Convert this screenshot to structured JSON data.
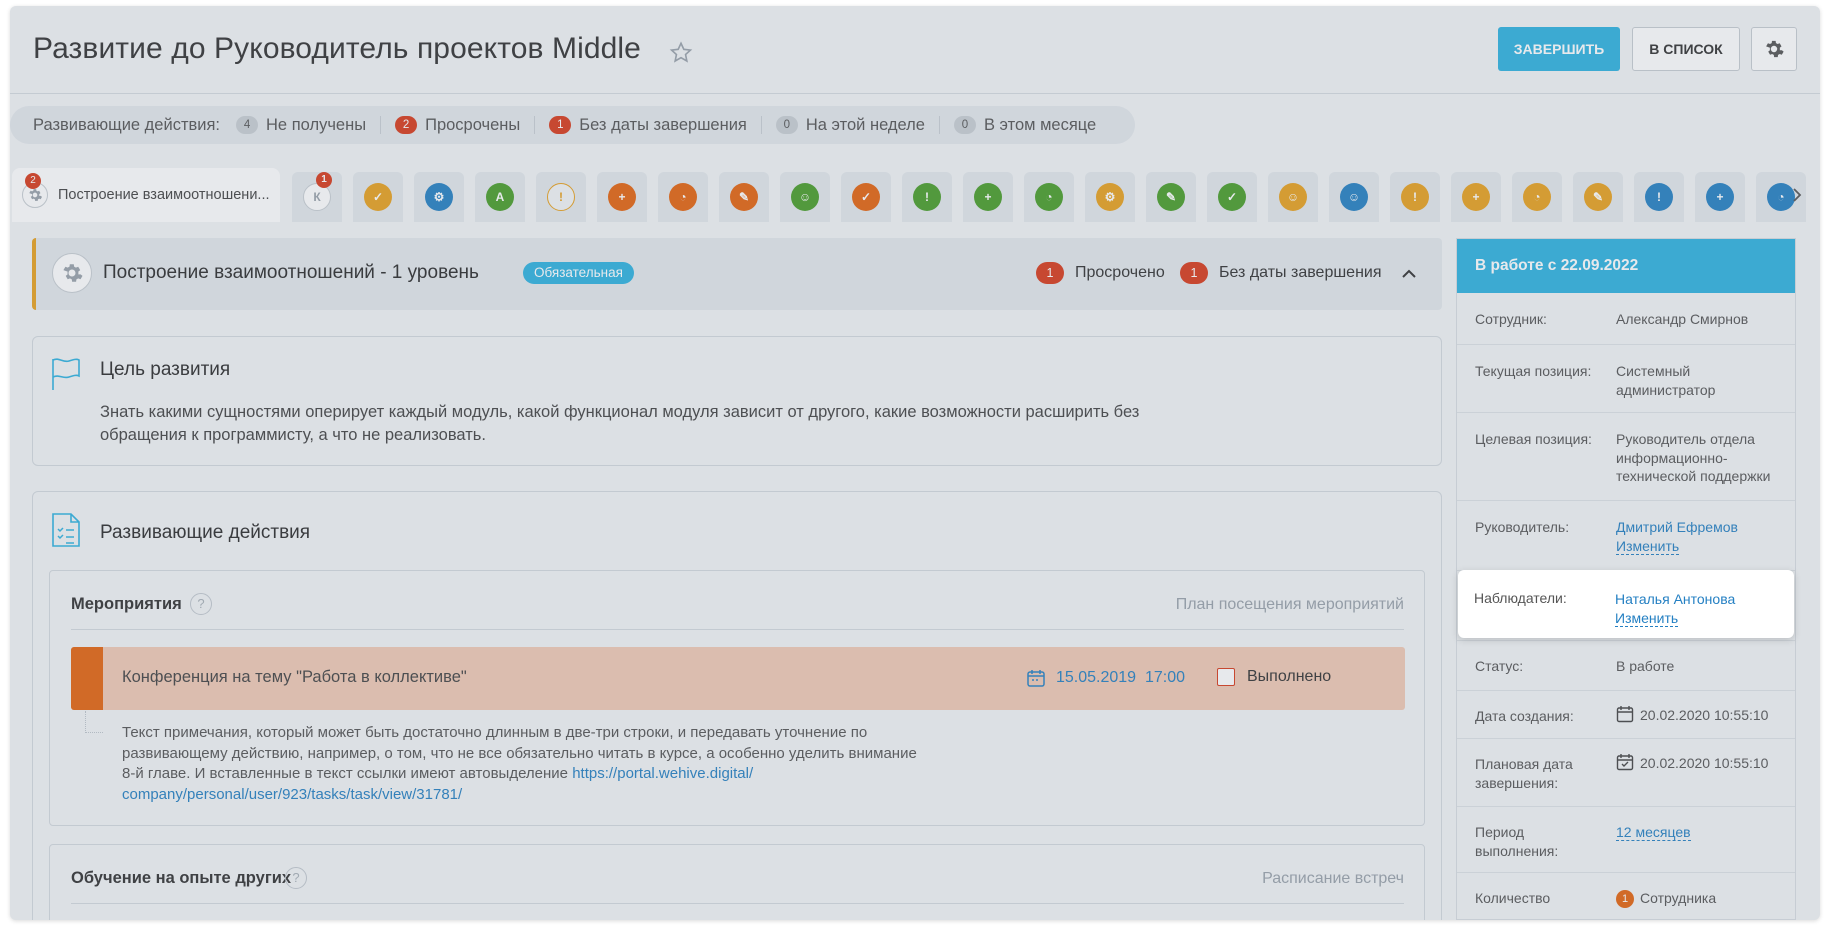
{
  "header": {
    "title": "Развитие до Руководитель проектов Middle",
    "finish_label": "ЗАВЕРШИТЬ",
    "list_label": "В СПИСОК"
  },
  "filters": {
    "label": "Развивающие действия:",
    "items": [
      {
        "count": "4",
        "label": "Не получены",
        "color": "#c9cfd4"
      },
      {
        "count": "2",
        "label": "Просрочены",
        "color": "#d83b1c"
      },
      {
        "count": "1",
        "label": "Без даты завершения",
        "color": "#d83b1c"
      },
      {
        "count": "0",
        "label": "На этой неделе",
        "color": "#c9cfd4"
      },
      {
        "count": "0",
        "label": "В этом месяце",
        "color": "#c9cfd4"
      }
    ]
  },
  "tabs": {
    "active": {
      "label": "Построение взаимоотношени...",
      "badge": "2"
    },
    "second": {
      "letter": "К",
      "badge": "1"
    },
    "icons": [
      {
        "name": "shield-check-icon",
        "color": "#e8a21f",
        "glyph": "✓"
      },
      {
        "name": "gear-icon",
        "color": "#2580c3",
        "glyph": "⚙"
      },
      {
        "name": "letter-a-icon",
        "color": "#4a9e2a",
        "glyph": "A"
      },
      {
        "name": "medal-icon",
        "color": "#f2f4f6",
        "glyph": "!"
      },
      {
        "name": "plus-box-icon",
        "color": "#e5640f",
        "glyph": "+"
      },
      {
        "name": "clock-shield-icon",
        "color": "#e5640f",
        "glyph": "◔"
      },
      {
        "name": "pencil-icon",
        "color": "#e5640f",
        "glyph": "✎"
      },
      {
        "name": "user-circle-icon",
        "color": "#4a9e2a",
        "glyph": "☺"
      },
      {
        "name": "shield-check-icon",
        "color": "#e5640f",
        "glyph": "✓"
      },
      {
        "name": "medal-icon",
        "color": "#4a9e2a",
        "glyph": "!"
      },
      {
        "name": "plus-box-icon",
        "color": "#4a9e2a",
        "glyph": "+"
      },
      {
        "name": "clock-shield-icon",
        "color": "#4a9e2a",
        "glyph": "◔"
      },
      {
        "name": "gear-icon",
        "color": "#e8a21f",
        "glyph": "⚙"
      },
      {
        "name": "pencil-icon",
        "color": "#4a9e2a",
        "glyph": "✎"
      },
      {
        "name": "shield-check-icon",
        "color": "#4a9e2a",
        "glyph": "✓"
      },
      {
        "name": "user-circle-icon",
        "color": "#e8a21f",
        "glyph": "☺"
      },
      {
        "name": "user-circle-icon",
        "color": "#2580c3",
        "glyph": "☺"
      },
      {
        "name": "medal-icon",
        "color": "#e8a21f",
        "glyph": "!"
      },
      {
        "name": "plus-box-icon",
        "color": "#e8a21f",
        "glyph": "+"
      },
      {
        "name": "clock-shield-icon",
        "color": "#e8a21f",
        "glyph": "◔"
      },
      {
        "name": "pencil-icon",
        "color": "#e8a21f",
        "glyph": "✎"
      },
      {
        "name": "medal-icon",
        "color": "#2580c3",
        "glyph": "!"
      },
      {
        "name": "plus-box-icon",
        "color": "#2580c3",
        "glyph": "+"
      },
      {
        "name": "clock-shield-icon",
        "color": "#2580c3",
        "glyph": "◔"
      }
    ]
  },
  "section": {
    "title": "Построение взаимоотношений - 1 уровень",
    "tag": "Обязательная",
    "overdue_count": "1",
    "overdue_label": "Просрочено",
    "nodate_count": "1",
    "nodate_label": "Без даты завершения"
  },
  "goal": {
    "title": "Цель развития",
    "text": "Знать какими сущностями оперирует каждый модуль, какой функционал модуля зависит от другого, какие возможности расширить без обращения к программисту, а что не реализовать."
  },
  "actions": {
    "title": "Развивающие действия",
    "events": {
      "title": "Мероприятия",
      "link": "План посещения мероприятий",
      "item": {
        "title": "Конференция на тему \"Работа в коллективе\"",
        "date": "15.05.2019",
        "time": "17:00",
        "done_label": "Выполнено",
        "note": "Текст примечания, который может быть достаточно длинным в две-три строки, и передавать уточнение по развивающему действию, например, о том, что не все обязательно читать в курсе, а особенно уделить внимание 8-й главе. И вставленные в текст ссылки имеют автовыделение ",
        "note_link": "https://portal.wehive.digital/ company/personal/user/923/tasks/task/view/31781/"
      }
    },
    "learning": {
      "title": "Обучение на опыте других",
      "link": "Расписание встреч"
    }
  },
  "panel": {
    "head": "В работе с 22.09.2022",
    "employee_label": "Сотрудник:",
    "employee": "Александр Смирнов",
    "current_label": "Текущая позиция:",
    "current": "Системный администратор",
    "target_label": "Целевая позиция:",
    "target": "Руководитель отдела информационно-технической поддержки",
    "manager_label": "Руководитель:",
    "manager": "Дмитрий Ефремов",
    "change_label": "Изменить",
    "observers_label": "Наблюдатели:",
    "observers": "Наталья Антонова",
    "status_label": "Статус:",
    "status": "В работе",
    "created_label": "Дата создания:",
    "created": "20.02.2020 10:55:10",
    "planned_label": "Плановая дата завершения:",
    "planned": "20.02.2020 10:55:10",
    "period_label": "Период выполнения:",
    "period": "12 месяцев",
    "qty_label": "Количество",
    "qty_count": "1",
    "qty_value": "Сотрудника"
  },
  "colors": {
    "accent": "#2fb2e0",
    "danger": "#d83b1c",
    "warning": "#e8a21f",
    "link": "#2580c3"
  }
}
